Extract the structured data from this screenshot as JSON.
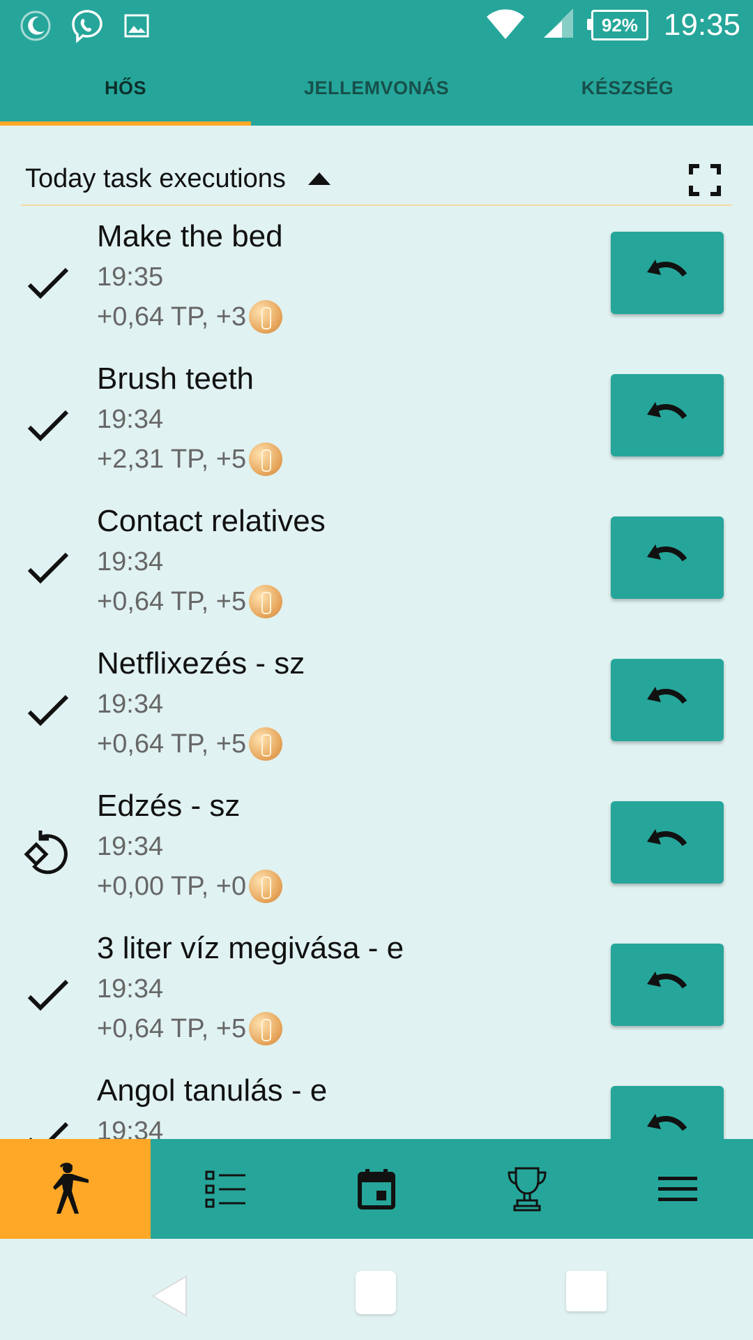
{
  "status_bar": {
    "battery": "92%",
    "time": "19:35",
    "left_icons": [
      "moon-icon",
      "viber-icon",
      "image-icon"
    ],
    "right_icons": [
      "wifi-icon",
      "signal-icon",
      "battery-icon"
    ]
  },
  "tabs": [
    {
      "label": "HŐS",
      "active": true
    },
    {
      "label": "JELLEMVONÁS",
      "active": false
    },
    {
      "label": "KÉSZSÉG",
      "active": false
    }
  ],
  "section": {
    "title": "Today task executions",
    "caret_icon": "caret-up-icon",
    "expand_icon": "fullscreen-icon"
  },
  "tasks": [
    {
      "name": "Make the bed",
      "time": "19:35",
      "reward": "+0,64 TP, +3",
      "status_icon": "check-icon"
    },
    {
      "name": "Brush teeth",
      "time": "19:34",
      "reward": "+2,31 TP, +5",
      "status_icon": "check-icon"
    },
    {
      "name": "Contact relatives",
      "time": "19:34",
      "reward": "+0,64 TP, +5",
      "status_icon": "check-icon"
    },
    {
      "name": "Netflixezés - sz",
      "time": "19:34",
      "reward": "+0,64 TP, +5",
      "status_icon": "check-icon"
    },
    {
      "name": "Edzés - sz",
      "time": "19:34",
      "reward": "+0,00 TP, +0",
      "status_icon": "skip-icon"
    },
    {
      "name": "3 liter víz megivása - e",
      "time": "19:34",
      "reward": "+0,64 TP, +5",
      "status_icon": "check-icon"
    },
    {
      "name": "Angol tanulás - e",
      "time": "19:34",
      "reward": "",
      "status_icon": "check-icon"
    }
  ],
  "bottom_nav": [
    {
      "icon": "hero-icon",
      "active": true
    },
    {
      "icon": "task-list-icon",
      "active": false
    },
    {
      "icon": "calendar-icon",
      "active": false
    },
    {
      "icon": "trophy-icon",
      "active": false
    },
    {
      "icon": "menu-icon",
      "active": false
    }
  ],
  "colors": {
    "primary": "#26a69a",
    "accent": "#ffa726",
    "background": "#e0f2f1"
  }
}
